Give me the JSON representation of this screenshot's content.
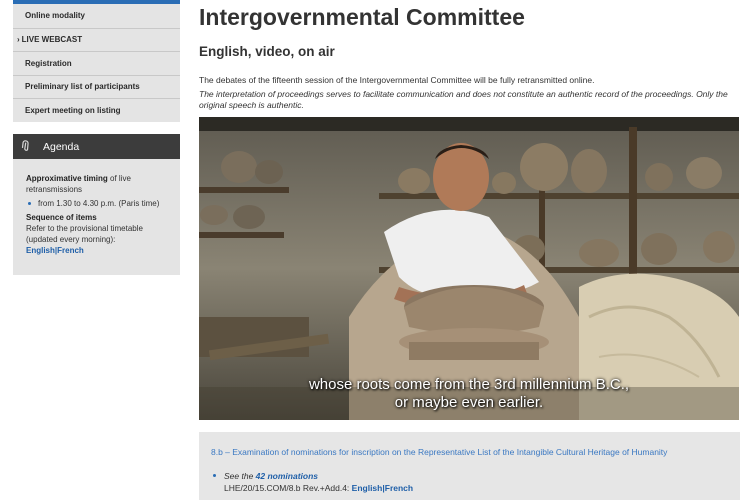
{
  "sidebar": {
    "nav_items": [
      {
        "label": "Online modality",
        "arrow": ""
      },
      {
        "label": "LIVE WEBCAST",
        "arrow": "›"
      },
      {
        "label": "Registration",
        "arrow": ""
      },
      {
        "label": "Preliminary list of participants",
        "arrow": ""
      },
      {
        "label": "Expert meeting on listing",
        "arrow": ""
      }
    ],
    "agenda": {
      "heading": "Agenda",
      "icon": "paperclip-icon",
      "timing_bold": "Approximative timing",
      "timing_rest": " of live retransmissions",
      "timing_bullet": "from 1.30 to 4.30 p.m. (Paris time)",
      "sequence_heading": "Sequence of items",
      "sequence_text": "Refer to the provisional timetable (updated every morning):",
      "lang_english": "English",
      "lang_sep": "|",
      "lang_french": "French"
    }
  },
  "main": {
    "title": "Intergovernmental Committee",
    "subtitle": "English, video, on air",
    "lead": "The debates of the fifteenth session of the Intergovernmental Committee will be fully retransmitted online.",
    "note": "The interpretation of proceedings serves to facilitate communication and does not constitute an authentic record of the proceedings. Only the original speech is authentic.",
    "video": {
      "caption_line1": "whose roots come from the 3rd millennium B.C.,",
      "caption_line2": "or maybe even earlier."
    },
    "item": {
      "title": "8.b – Examination of nominations for inscription on the Representative List of the Intangible Cultural Heritage of Humanity",
      "see_prefix": "See the ",
      "see_link": "42 nominations",
      "doc_ref": "LHE/20/15.COM/8.b Rev.+Add.4: ",
      "lang_english": "English",
      "lang_sep": "|",
      "lang_french": "French"
    }
  },
  "colors": {
    "accent": "#2a6db5",
    "link": "#1f5fa8",
    "sidebar_bg": "#e4e4e4",
    "agenda_header": "#3c3c3c",
    "info_title": "#3a78c2"
  }
}
